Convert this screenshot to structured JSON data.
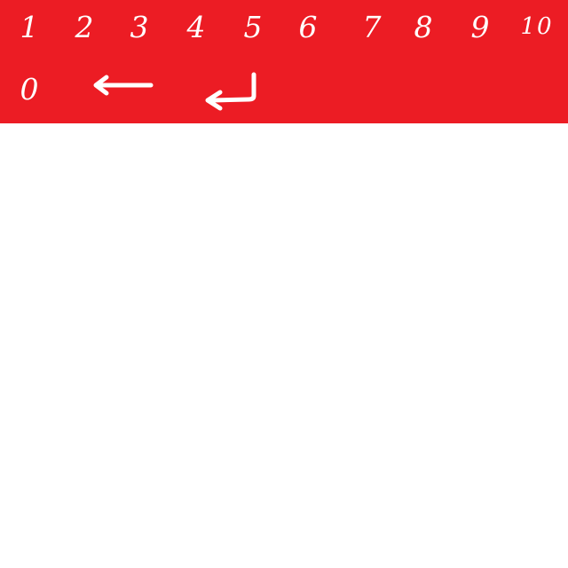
{
  "keypad": {
    "background_color": "#ec1c24",
    "key_color": "#ffffff",
    "row1": [
      {
        "label": "1"
      },
      {
        "label": "2"
      },
      {
        "label": "3"
      },
      {
        "label": "4"
      },
      {
        "label": "5"
      },
      {
        "label": "6"
      },
      {
        "label": "7"
      },
      {
        "label": "8"
      },
      {
        "label": "9"
      },
      {
        "label": "10"
      }
    ],
    "row2": {
      "zero": {
        "label": "0"
      },
      "backspace": {
        "icon": "left-arrow-icon"
      },
      "enter": {
        "icon": "enter-return-icon"
      }
    }
  }
}
